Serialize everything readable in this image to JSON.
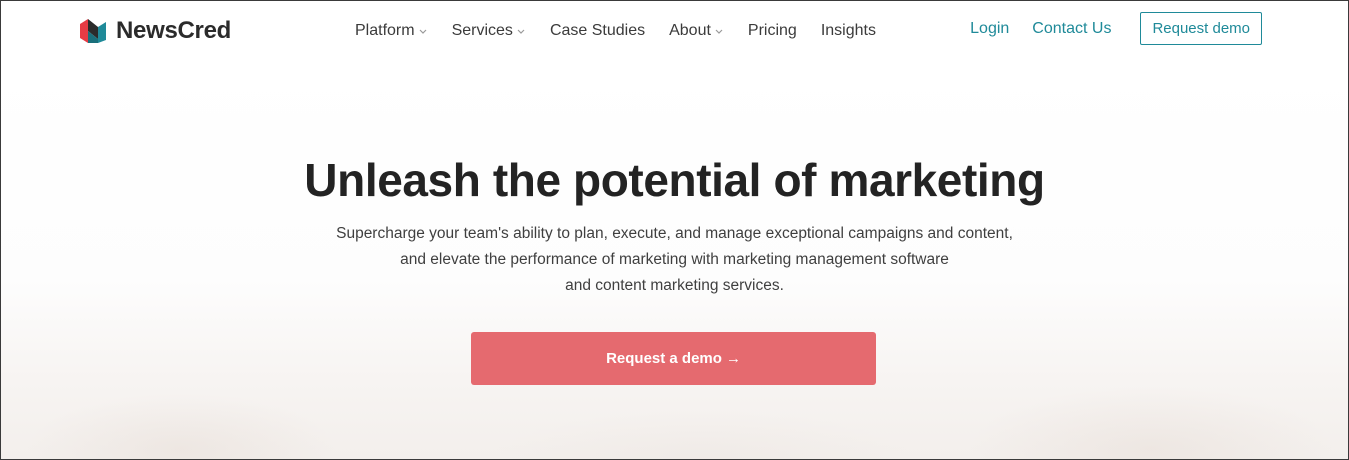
{
  "brand": {
    "name": "NewsCred",
    "logo_colors": [
      "#2b2b2b",
      "#e63b44",
      "#1f8a99"
    ]
  },
  "nav": {
    "items": [
      {
        "label": "Platform",
        "has_dropdown": true
      },
      {
        "label": "Services",
        "has_dropdown": true
      },
      {
        "label": "Case Studies",
        "has_dropdown": false
      },
      {
        "label": "About",
        "has_dropdown": true
      },
      {
        "label": "Pricing",
        "has_dropdown": false
      },
      {
        "label": "Insights",
        "has_dropdown": false
      }
    ]
  },
  "header_actions": {
    "login_label": "Login",
    "contact_label": "Contact Us",
    "request_demo_label": "Request demo"
  },
  "hero": {
    "title": "Unleash the potential of marketing",
    "subtitle_lines": [
      "Supercharge your team's ability to plan, execute, and manage exceptional campaigns and content,",
      "and elevate the performance of marketing with marketing management software",
      "and content marketing services."
    ],
    "cta_label": "Request a demo",
    "cta_arrow": "→"
  },
  "colors": {
    "accent_teal": "#1f8a99",
    "cta_red": "#e56a6f",
    "text_dark": "#232323"
  }
}
